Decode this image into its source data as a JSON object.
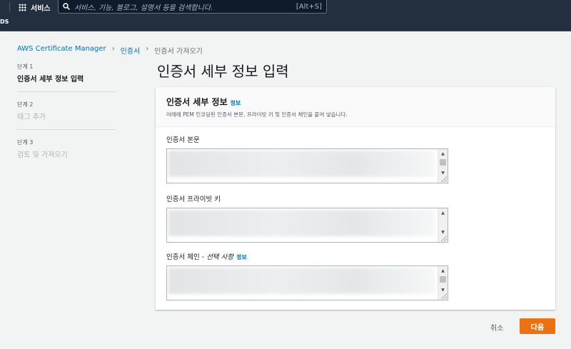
{
  "nav": {
    "services": "서비스",
    "search_placeholder": "서비스, 기능, 블로그, 설명서 등을 검색합니다.",
    "shortcut": "[Alt+S]",
    "region_fragment": "DS"
  },
  "breadcrumb": [
    "AWS Certificate Manager",
    "인증서",
    "인증서 가져오기"
  ],
  "steps": [
    {
      "num": "단계 1",
      "title": "인증서 세부 정보 입력"
    },
    {
      "num": "단계 2",
      "title": "태그 추가"
    },
    {
      "num": "단계 3",
      "title": "검토 및 가져오기"
    }
  ],
  "page_title": "인증서 세부 정보 입력",
  "panel": {
    "title": "인증서 세부 정보",
    "info": "정보",
    "description": "아래에 PEM 인코딩된 인증서 본문, 프라이빗 키 및 인증서 체인을 붙여 넣습니다.",
    "fields": [
      {
        "label": "인증서 본문"
      },
      {
        "label": "인증서 프라이빗 키"
      },
      {
        "label": "인증서 체인 - ",
        "optional": "선택 사항",
        "info": "정보"
      }
    ]
  },
  "buttons": {
    "cancel": "취소",
    "next": "다음"
  }
}
